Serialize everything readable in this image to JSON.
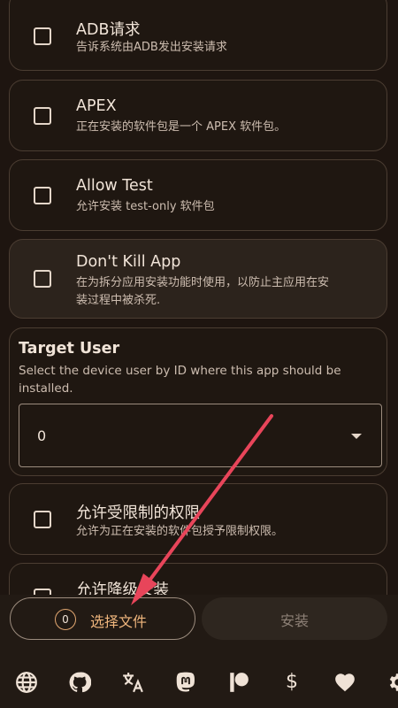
{
  "options": [
    {
      "title": "ADB请求",
      "desc": [
        "告诉系统由ADB发出安装请求"
      ]
    },
    {
      "title": "APEX",
      "desc": [
        "正在安装的软件包是一个 APEX 软件包。"
      ]
    },
    {
      "title": "Allow Test",
      "desc": [
        "允许安装 test-only 软件包"
      ]
    },
    {
      "title": "Don't Kill App",
      "desc": [
        "在为拆分应用安装功能时使用，以防止主应用在安",
        "装过程中被杀死."
      ]
    },
    {
      "title": "允许受限制的权限",
      "desc": [
        "允许为正在安装的软件包授予限制权限。"
      ]
    },
    {
      "title": "允许降级安装",
      "desc": []
    }
  ],
  "target_user": {
    "title": "Target User",
    "desc": "Select the device user by ID where this app should be installed.",
    "value": "0"
  },
  "bottom": {
    "count": "0",
    "select_label": "选择文件",
    "install_label": "安装"
  },
  "icons": [
    "globe-icon",
    "github-icon",
    "translate-icon",
    "mastodon-icon",
    "patreon-icon",
    "dollar-icon",
    "heart-icon",
    "gear-icon"
  ],
  "colors": {
    "accent": "#f0b67d",
    "background": "#1e1510",
    "annotation_arrow": "#e8455a"
  }
}
